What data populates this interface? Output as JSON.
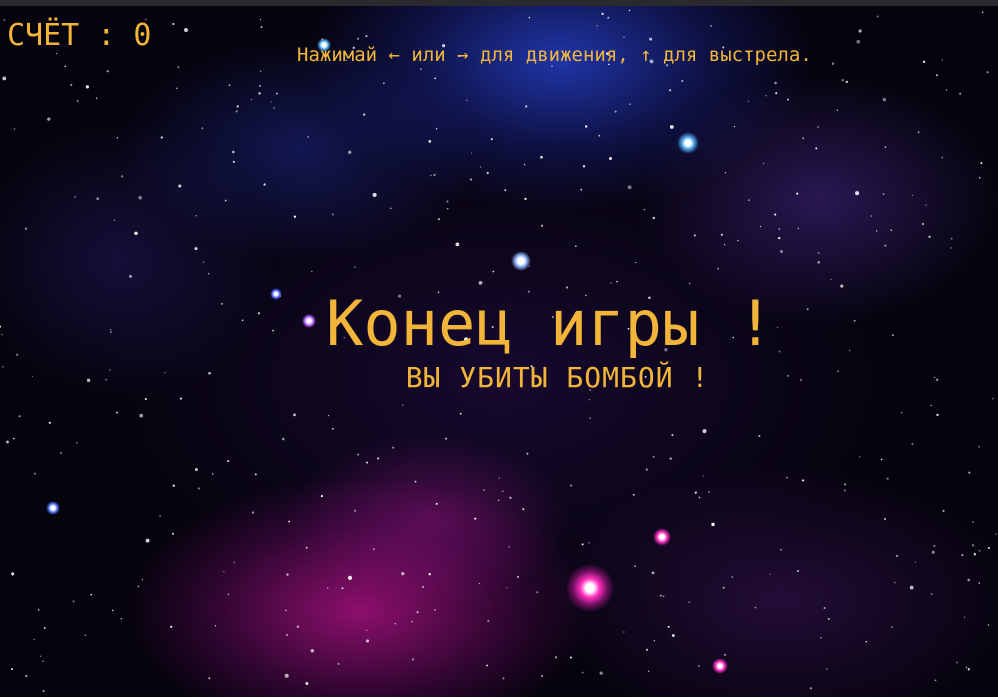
{
  "hud": {
    "score_label": "СЧЁТ : 0",
    "controls_hint": "Нажимай ← или → для движения, ↑ для выстрела."
  },
  "game_over": {
    "title": "Конец игры !",
    "reason": "ВЫ УБИТЫ БОМБОЙ !"
  },
  "colors": {
    "text": "#f2b53a",
    "background": "#05030d",
    "bright_star_blue": "#5ab8ff",
    "bright_star_pink": "#ff2fbf"
  }
}
